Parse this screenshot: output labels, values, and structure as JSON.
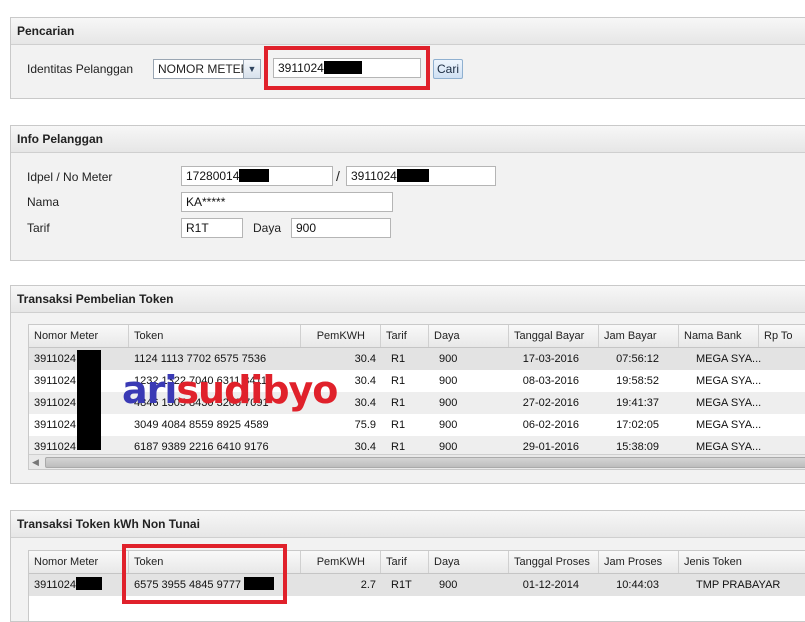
{
  "search": {
    "title": "Pencarian",
    "label": "Identitas Pelanggan",
    "type_selected": "NOMOR METER",
    "meter_value": "3911024",
    "search_button": "Cari"
  },
  "customer": {
    "title": "Info Pelanggan",
    "idpel_label": "Idpel / No Meter",
    "idpel_value": "17280014",
    "separator": "/",
    "meter_value": "3911024",
    "name_label": "Nama",
    "name_value": "KA*****",
    "tarif_label": "Tarif",
    "tarif_value": "R1T",
    "daya_label": "Daya",
    "daya_value": "900"
  },
  "purchases": {
    "title": "Transaksi Pembelian Token",
    "columns": [
      "Nomor Meter",
      "Token",
      "PemKWH",
      "Tarif",
      "Daya",
      "Tanggal Bayar",
      "Jam Bayar",
      "Nama Bank",
      "Rp To"
    ],
    "rows": [
      {
        "meter": "3911024",
        "token": "1124 1113 7702 6575 7536",
        "kwh": "30.4",
        "tarif": "R1",
        "daya": "900",
        "date": "17-03-2016",
        "time": "07:56:12",
        "bank": "MEGA SYA..."
      },
      {
        "meter": "3911024",
        "token": "1232 1322 7040 6311 3411",
        "kwh": "30.4",
        "tarif": "R1",
        "daya": "900",
        "date": "08-03-2016",
        "time": "19:58:52",
        "bank": "MEGA SYA..."
      },
      {
        "meter": "3911024",
        "token": "4846 1305 8430 3200 7091",
        "kwh": "30.4",
        "tarif": "R1",
        "daya": "900",
        "date": "27-02-2016",
        "time": "19:41:37",
        "bank": "MEGA SYA..."
      },
      {
        "meter": "3911024",
        "token": "3049 4084 8559 8925 4589",
        "kwh": "75.9",
        "tarif": "R1",
        "daya": "900",
        "date": "06-02-2016",
        "time": "17:02:05",
        "bank": "MEGA SYA..."
      },
      {
        "meter": "3911024",
        "token": "6187 9389 2216 6410 9176",
        "kwh": "30.4",
        "tarif": "R1",
        "daya": "900",
        "date": "29-01-2016",
        "time": "15:38:09",
        "bank": "MEGA SYA..."
      }
    ]
  },
  "noncash": {
    "title": "Transaksi Token kWh Non Tunai",
    "columns": [
      "Nomor Meter",
      "Token",
      "PemKWH",
      "Tarif",
      "Daya",
      "Tanggal Proses",
      "Jam Proses",
      "Jenis Token"
    ],
    "rows": [
      {
        "meter": "3911024",
        "token": "6575 3955 4845 9777",
        "kwh": "2.7",
        "tarif": "R1T",
        "daya": "900",
        "date": "01-12-2014",
        "time": "10:44:03",
        "type": "TMP PRABAYAR"
      }
    ]
  },
  "watermark": {
    "part1": "ari",
    "part2": "sudibyo"
  },
  "colors": {
    "highlight": "#e0212b",
    "watermark_blue": "#3a3ab5",
    "watermark_red": "#e0212b"
  }
}
